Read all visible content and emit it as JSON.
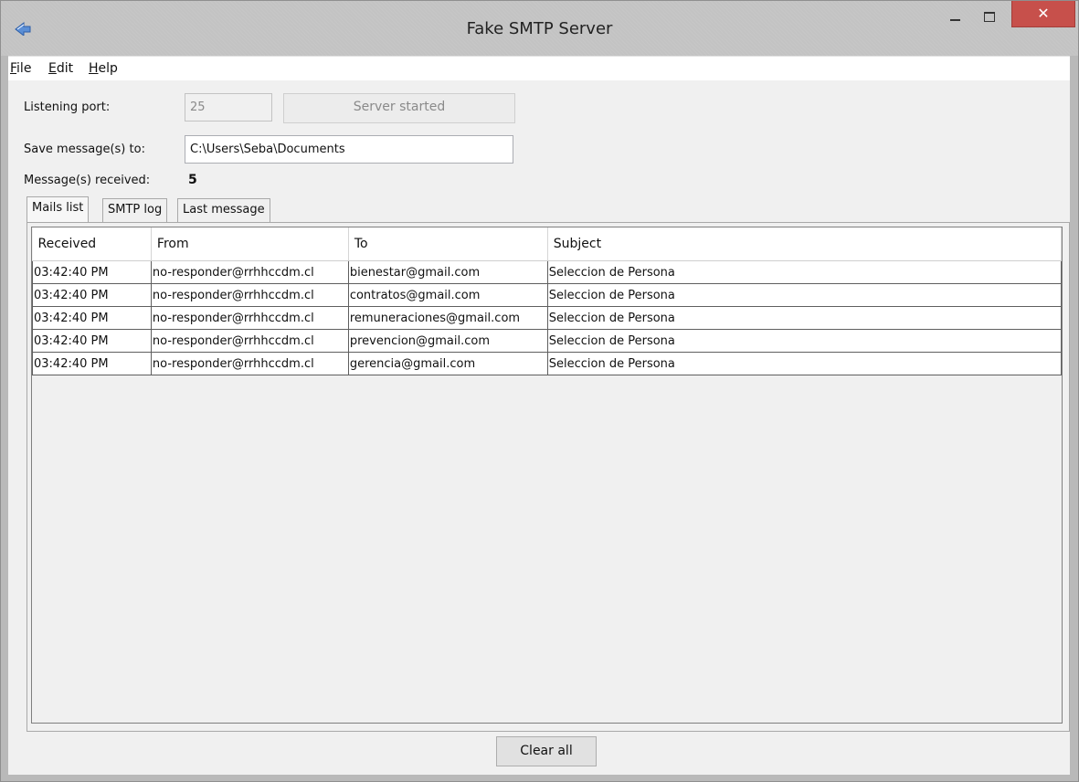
{
  "window": {
    "title": "Fake SMTP Server",
    "close_glyph": "✕"
  },
  "icons": {
    "app": "envelope-arrow-icon",
    "minimize": "minimize-icon",
    "maximize": "maximize-icon",
    "close": "close-icon"
  },
  "menu": {
    "file": {
      "mnemonic": "F",
      "rest": "ile"
    },
    "edit": {
      "mnemonic": "E",
      "rest": "dit"
    },
    "help": {
      "mnemonic": "H",
      "rest": "elp"
    }
  },
  "form": {
    "port_label": "Listening port:",
    "port_value": "25",
    "server_button": "Server started",
    "save_label": "Save message(s) to:",
    "save_path": "C:\\Users\\Seba\\Documents",
    "received_label": "Message(s) received:",
    "received_count": "5"
  },
  "tabs": [
    "Mails list",
    "SMTP log",
    "Last message"
  ],
  "active_tab": "Mails list",
  "table": {
    "columns": [
      "Received",
      "From",
      "To",
      "Subject"
    ],
    "rows": [
      [
        "03:42:40 PM",
        "no-responder@rrhhccdm.cl",
        "bienestar@gmail.com",
        "Seleccion de Persona"
      ],
      [
        "03:42:40 PM",
        "no-responder@rrhhccdm.cl",
        "contratos@gmail.com",
        "Seleccion de Persona"
      ],
      [
        "03:42:40 PM",
        "no-responder@rrhhccdm.cl",
        "remuneraciones@gmail.com",
        "Seleccion de Persona"
      ],
      [
        "03:42:40 PM",
        "no-responder@rrhhccdm.cl",
        "prevencion@gmail.com",
        "Seleccion de Persona"
      ],
      [
        "03:42:40 PM",
        "no-responder@rrhhccdm.cl",
        "gerencia@gmail.com",
        "Seleccion de Persona"
      ]
    ]
  },
  "footer": {
    "clear_button": "Clear all"
  },
  "colors": {
    "close_button": "#c7504b",
    "titlebar": "#c3c3c3",
    "panel": "#f0f0f0"
  }
}
